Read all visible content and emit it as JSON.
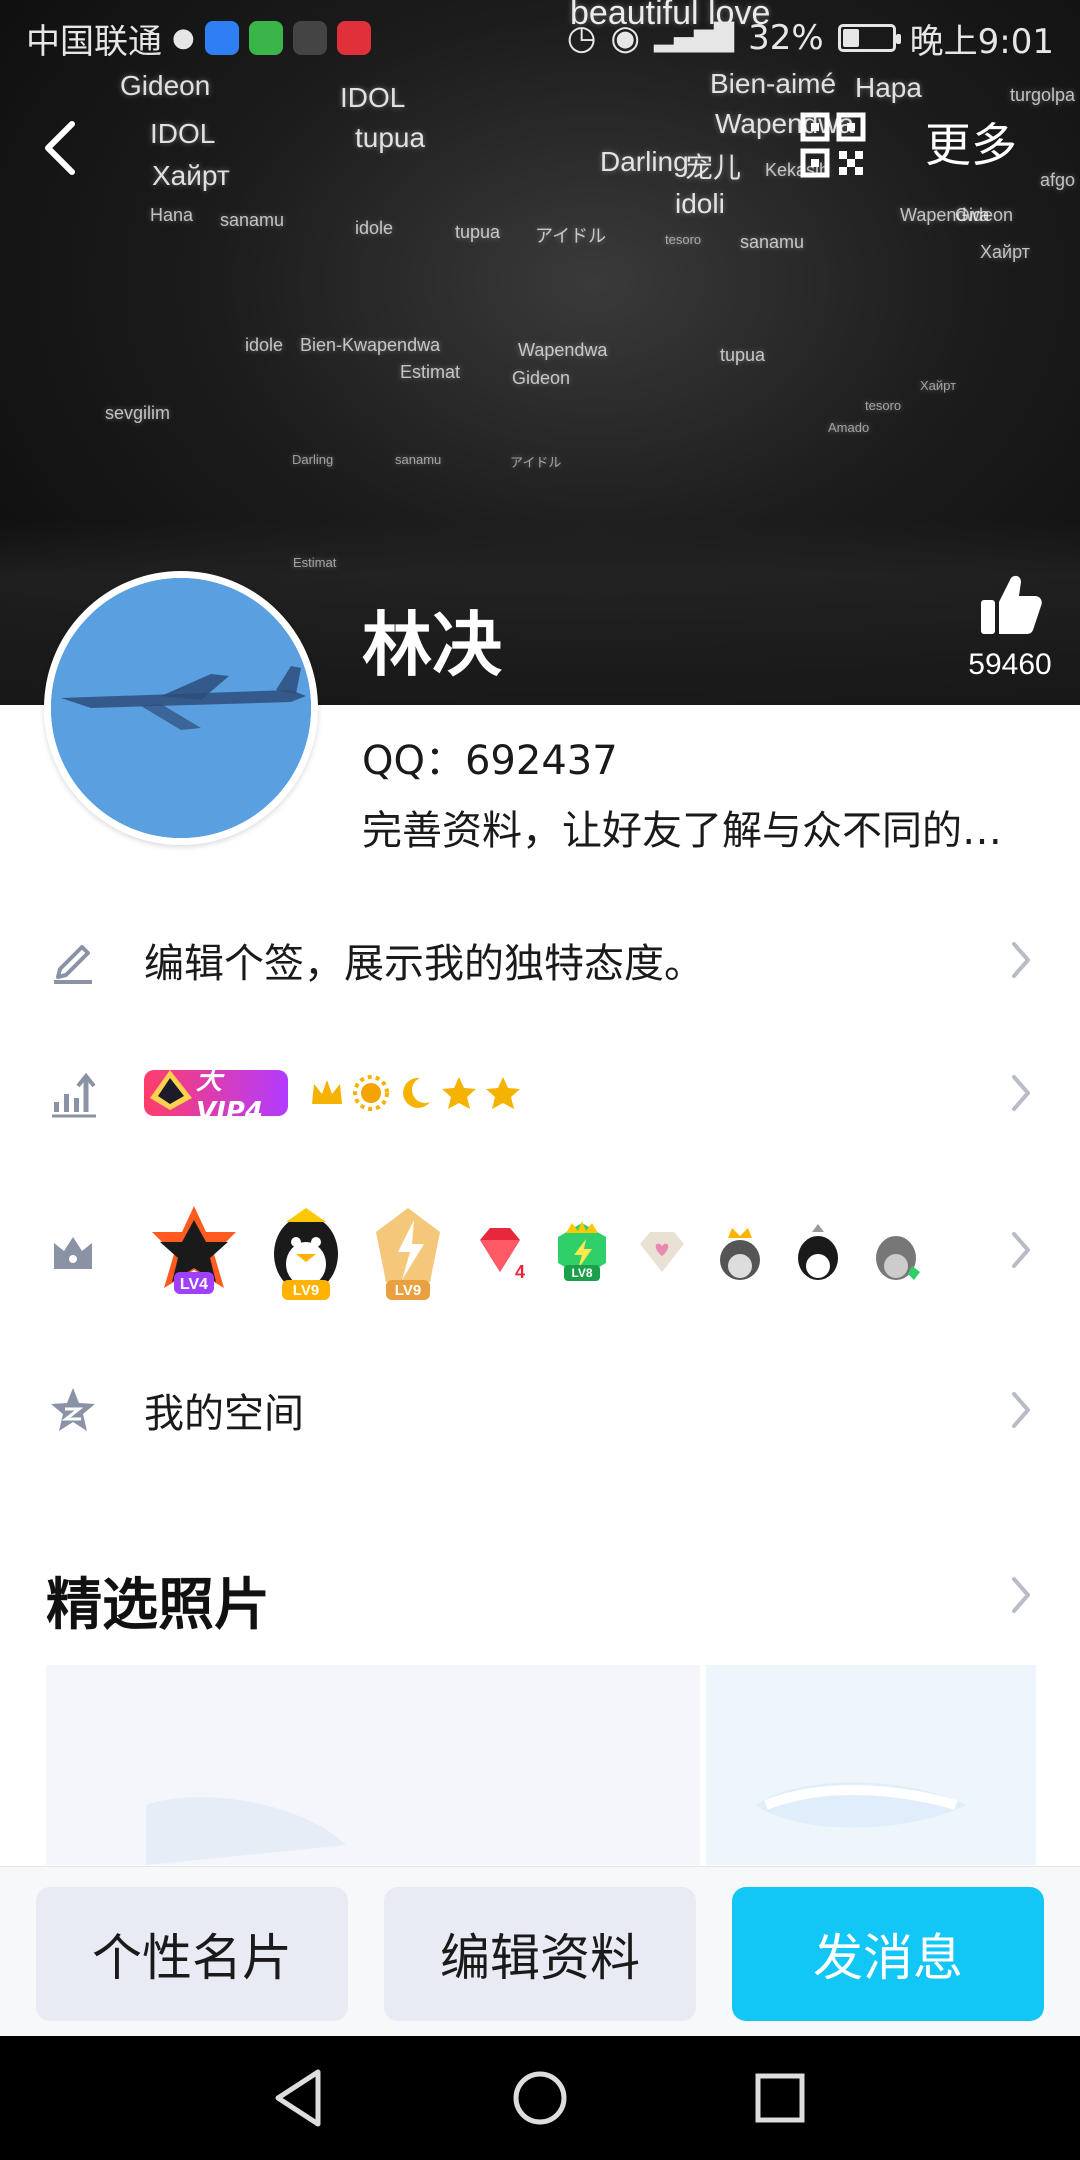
{
  "status_bar": {
    "carrier": "中国联通",
    "battery": "32%",
    "battery_level": 0.32,
    "time": "晚上9:01"
  },
  "nav": {
    "more_label": "更多"
  },
  "cover": {
    "words": [
      "beautiful love",
      "Gideon",
      "IDOL",
      "IDOL",
      "Хайрт",
      "tupua",
      "Bien-aimé",
      "Hapa",
      "Wapendwa",
      "Darling",
      "宠儿",
      "idoli",
      "Kekasih",
      "Hana",
      "sanamu",
      "idole",
      "tupua",
      "アイドル",
      "tesoro",
      "sanamu",
      "Wapendwa",
      "Gideon",
      "turgolpa",
      "afgo",
      "Хайрт",
      "idole",
      "Bien-Kwapendwa",
      "Estimat",
      "Gideon",
      "Wapendwa",
      "tupua",
      "sevgilim",
      "Darling",
      "sanamu",
      "アイドル",
      "Estimat",
      "tesoro",
      "Amado",
      "Хайрт"
    ]
  },
  "profile": {
    "nickname": "林决",
    "likes": "59460",
    "qq_line": "QQ：692437",
    "bio": "完善资料，让好友了解与众不同的…"
  },
  "rows": {
    "signature": "编辑个签，展示我的独特态度。",
    "vip_label": "大VIP4",
    "zone": "我的空间"
  },
  "badges": {
    "labels": [
      "LV4",
      "LV9",
      "LV9",
      "4",
      "LV8"
    ]
  },
  "photos_section": {
    "title": "精选照片"
  },
  "actions": {
    "card": "个性名片",
    "edit": "编辑资料",
    "message": "发消息"
  },
  "colors": {
    "accent": "#12c7f5",
    "gray_button": "#e8ebf3",
    "vip_start": "#ff3d6a",
    "vip_end": "#b23bff"
  }
}
